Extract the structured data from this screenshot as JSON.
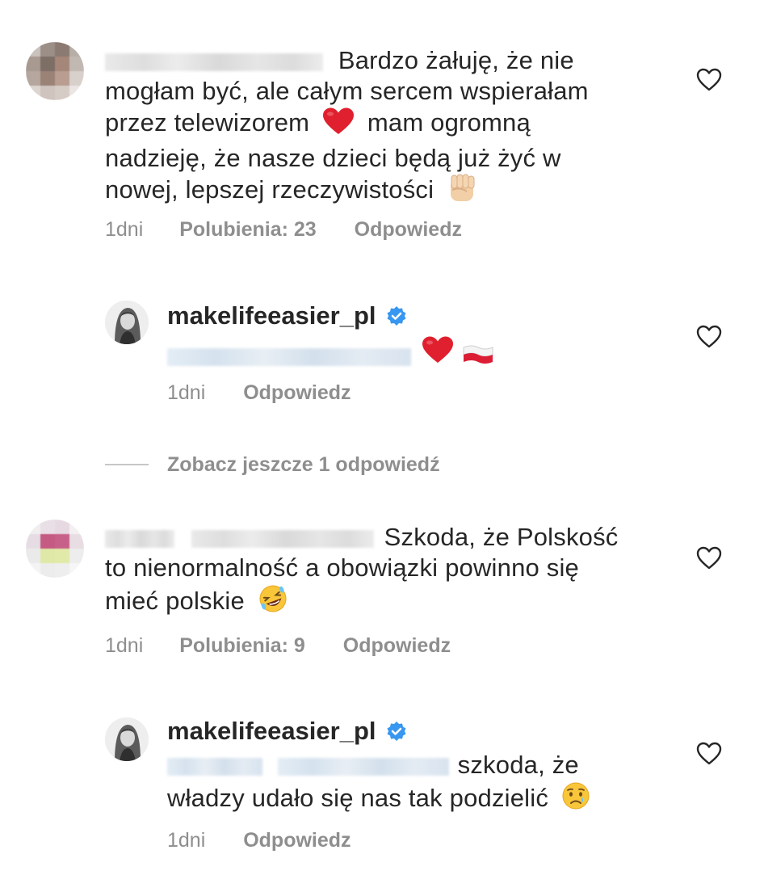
{
  "comments": [
    {
      "text_lines": [
        "Bardzo żałuję, że nie",
        "mogłam być, ale całym sercem wspierałam",
        "przez telewizorem",
        "mam ogromną",
        "nadzieję, że nasze dzieci będą już żyć w",
        "nowej, lepszej rzeczywistości"
      ],
      "time": "1dni",
      "likes": "Polubienia: 23",
      "reply": "Odpowiedz",
      "emoji": [
        "red-heart-emoji",
        "raised-fist-emoji"
      ]
    },
    {
      "text_lines": [
        "Szkoda, że Polskość",
        "to nienormalność a obowiązki powinno się",
        "mieć polskie"
      ],
      "time": "1dni",
      "likes": "Polubienia: 9",
      "reply": "Odpowiedz",
      "emoji": [
        "rofl-emoji"
      ]
    }
  ],
  "replies": [
    {
      "username": "makelifeeasier_pl",
      "time": "1dni",
      "reply": "Odpowiedz",
      "emoji": [
        "red-heart-emoji",
        "poland-flag-emoji"
      ]
    },
    {
      "username": "makelifeeasier_pl",
      "text_lines": [
        "szkoda, że",
        "władzy udało się nas tak podzielić"
      ],
      "time": "1dni",
      "reply": "Odpowiedz",
      "emoji": [
        "crying-face-emoji"
      ]
    }
  ],
  "view_more": "Zobacz jeszcze 1 odpowiedź",
  "colors": {
    "text": "#262626",
    "meta": "#8e8e8e",
    "verified": "#3897f0",
    "heart_emoji": "#e0202e"
  }
}
